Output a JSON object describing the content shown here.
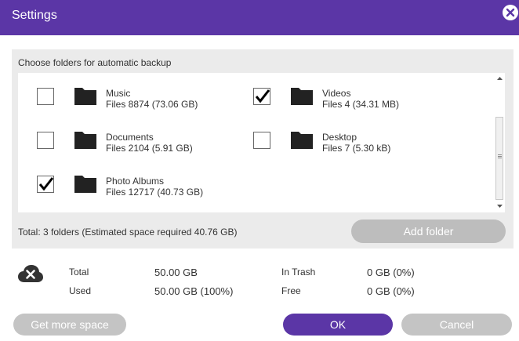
{
  "window": {
    "title": "Settings"
  },
  "backup": {
    "section_label": "Choose folders for automatic backup",
    "folders": [
      {
        "name": "Music",
        "info": "Files 8874 (73.06 GB)",
        "checked": false
      },
      {
        "name": "Videos",
        "info": "Files 4 (34.31 MB)",
        "checked": true
      },
      {
        "name": "Documents",
        "info": "Files 2104 (5.91 GB)",
        "checked": false
      },
      {
        "name": "Desktop",
        "info": "Files 7 (5.30 kB)",
        "checked": false
      },
      {
        "name": "Photo Albums",
        "info": "Files 12717 (40.73 GB)",
        "checked": true
      }
    ],
    "total_text": "Total: 3 folders (Estimated space required 40.76 GB)",
    "add_folder_label": "Add folder"
  },
  "storage": {
    "total_label": "Total",
    "total_value": "50.00 GB",
    "used_label": "Used",
    "used_value": "50.00 GB (100%)",
    "trash_label": "In Trash",
    "trash_value": "0 GB (0%)",
    "free_label": "Free",
    "free_value": "0 GB (0%)"
  },
  "footer": {
    "get_more_label": "Get more space",
    "ok_label": "OK",
    "cancel_label": "Cancel"
  },
  "colors": {
    "accent": "#5b36a6",
    "button_gray": "#c4c4c4"
  },
  "icons": {
    "close": "close-icon",
    "folder": "folder-icon",
    "check": "checkmark-icon",
    "cloud": "cloud-error-icon"
  }
}
